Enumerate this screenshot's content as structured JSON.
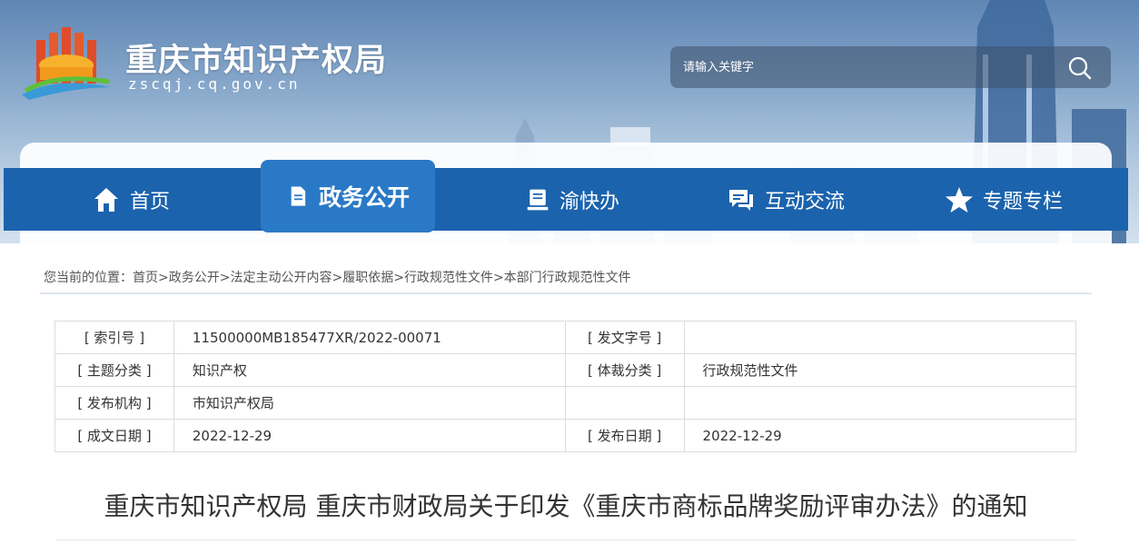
{
  "site": {
    "title": "重庆市知识产权局",
    "domain": "zscqj.cq.gov.cn"
  },
  "search": {
    "placeholder": "请输入关键字",
    "icon": "search-icon"
  },
  "nav": {
    "items": [
      {
        "label": "首页",
        "icon": "home-icon"
      },
      {
        "label": "政务公开",
        "icon": "document-icon",
        "active": true
      },
      {
        "label": "渝快办",
        "icon": "service-icon"
      },
      {
        "label": "互动交流",
        "icon": "chat-icon"
      },
      {
        "label": "专题专栏",
        "icon": "star-icon"
      }
    ]
  },
  "breadcrumb": {
    "prefix": "您当前的位置：",
    "separator": ">",
    "items": [
      "首页",
      "政务公开",
      "法定主动公开内容",
      "履职依据",
      "行政规范性文件",
      "本部门行政规范性文件"
    ]
  },
  "meta": {
    "rows": [
      {
        "k1": "[ 索引号 ]",
        "v1": "11500000MB185477XR/2022-00071",
        "k2": "[ 发文字号 ]",
        "v2": ""
      },
      {
        "k1": "[ 主题分类 ]",
        "v1": "知识产权",
        "k2": "[ 体裁分类 ]",
        "v2": "行政规范性文件"
      },
      {
        "k1": "[ 发布机构 ]",
        "v1": "市知识产权局",
        "k2": "",
        "v2": ""
      },
      {
        "k1": "[ 成文日期 ]",
        "v1": "2022-12-29",
        "k2": "[ 发布日期 ]",
        "v2": "2022-12-29"
      }
    ]
  },
  "document": {
    "title": "重庆市知识产权局 重庆市财政局关于印发《重庆市商标品牌奖励评审办法》的通知"
  },
  "colors": {
    "nav": "#1b63ad",
    "nav_active": "#2a79c7",
    "header_sky": "#86a7ca"
  }
}
